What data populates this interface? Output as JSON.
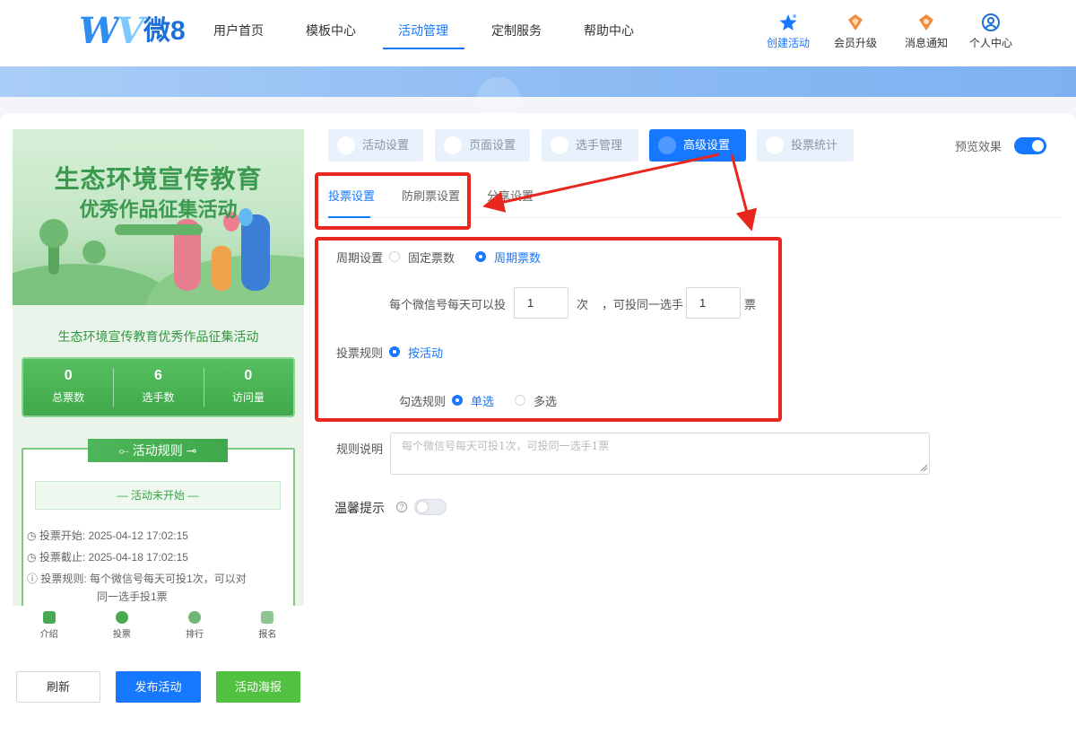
{
  "brand": {
    "logo_mark": "W",
    "logo_text": "微8"
  },
  "nav": {
    "items": [
      "用户首页",
      "模板中心",
      "活动管理",
      "定制服务",
      "帮助中心"
    ],
    "active": "活动管理"
  },
  "tools": [
    {
      "label": "创建活动",
      "icon": "star-icon"
    },
    {
      "label": "会员升级",
      "icon": "vip-icon"
    },
    {
      "label": "消息通知",
      "icon": "bell-icon"
    },
    {
      "label": "个人中心",
      "icon": "user-icon"
    }
  ],
  "preview": {
    "poster_title_1": "生态环境宣传教育",
    "poster_title_2": "优秀作品征集活动",
    "activity_title": "生态环境宣传教育优秀作品征集活动",
    "stats": [
      {
        "value": "0",
        "label": "总票数"
      },
      {
        "value": "6",
        "label": "选手数"
      },
      {
        "value": "0",
        "label": "访问量"
      }
    ],
    "rules_heading": "活动规则",
    "status": "活动未开始",
    "vote_start_label": "投票开始:",
    "vote_start": "2025-04-12 17:02:15",
    "vote_end_label": "投票截止:",
    "vote_end": "2025-04-18 17:02:15",
    "vote_rule_label": "投票规则:",
    "vote_rule_1": "每个微信号每天可投1次，可以对",
    "vote_rule_2": "同一选手投1票",
    "tabs": [
      "介绍",
      "投票",
      "排行",
      "报名"
    ]
  },
  "buttons": {
    "refresh": "刷新",
    "publish": "发布活动",
    "poster": "活动海报"
  },
  "steps": [
    "活动设置",
    "页面设置",
    "选手管理",
    "高级设置",
    "投票统计"
  ],
  "active_step": "高级设置",
  "preview_toggle": {
    "label": "预览效果",
    "on": true
  },
  "subtabs": [
    "投票设置",
    "防刷票设置",
    "分享设置"
  ],
  "active_subtab": "投票设置",
  "form": {
    "period_label": "周期设置",
    "period_options": [
      "固定票数",
      "周期票数"
    ],
    "period_selected": "周期票数",
    "per_day_prefix": "每个微信号每天可以投",
    "per_day_value": "1",
    "per_day_unit": "次",
    "same_player_prefix": "，可投同一选手",
    "same_player_value": "1",
    "same_player_unit": "票",
    "rule_label": "投票规则",
    "rule_option": "按活动",
    "select_rule_label": "勾选规则",
    "select_options": [
      "单选",
      "多选"
    ],
    "select_selected": "单选",
    "desc_label": "规则说明",
    "desc_value": "每个微信号每天可投1次，可投同一选手1票",
    "tip_label": "温馨提示",
    "tip_on": false
  },
  "colors": {
    "primary": "#1677ff",
    "highlight": "#e8271f",
    "green": "#52c041"
  }
}
